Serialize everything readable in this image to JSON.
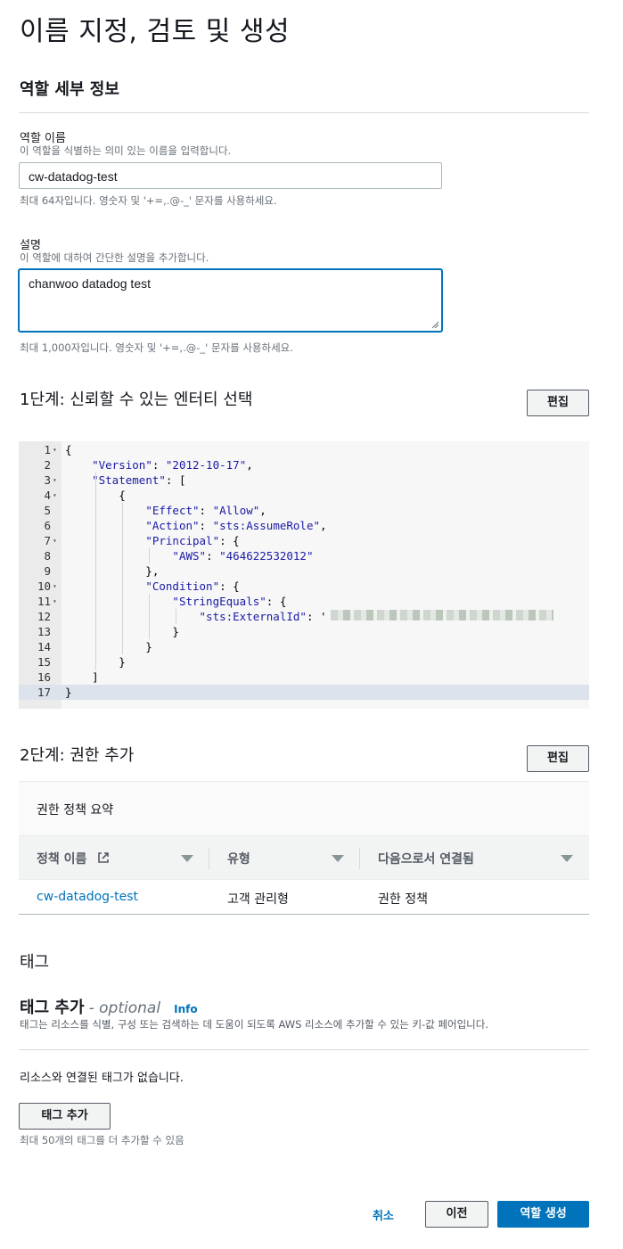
{
  "page": {
    "title": "이름 지정, 검토 및 생성"
  },
  "role_details": {
    "heading": "역할 세부 정보",
    "name": {
      "label": "역할 이름",
      "description": "이 역할을 식별하는 의미 있는 이름을 입력합니다.",
      "value": "cw-datadog-test",
      "hint": "최대 64자입니다. 영숫자 및 '+=,.@-_' 문자를 사용하세요."
    },
    "description": {
      "label": "설명",
      "description": "이 역할에 대하여 간단한 설명을 추가합니다.",
      "value": "chanwoo datadog test",
      "hint": "최대 1,000자입니다. 영숫자 및 '+=,.@-_' 문자를 사용하세요."
    }
  },
  "step1": {
    "heading": "1단계: 신뢰할 수 있는 엔터티 선택",
    "edit_label": "편집",
    "code_lines": [
      {
        "n": "1",
        "fold": true,
        "text": "{"
      },
      {
        "n": "2",
        "fold": false,
        "text": "    \"Version\": \"2012-10-17\","
      },
      {
        "n": "3",
        "fold": true,
        "text": "    \"Statement\": ["
      },
      {
        "n": "4",
        "fold": true,
        "text": "        {"
      },
      {
        "n": "5",
        "fold": false,
        "text": "            \"Effect\": \"Allow\","
      },
      {
        "n": "6",
        "fold": false,
        "text": "            \"Action\": \"sts:AssumeRole\","
      },
      {
        "n": "7",
        "fold": true,
        "text": "            \"Principal\": {"
      },
      {
        "n": "8",
        "fold": false,
        "text": "                \"AWS\": \"464622532012\""
      },
      {
        "n": "9",
        "fold": false,
        "text": "            },"
      },
      {
        "n": "10",
        "fold": true,
        "text": "            \"Condition\": {"
      },
      {
        "n": "11",
        "fold": true,
        "text": "                \"StringEquals\": {"
      },
      {
        "n": "12",
        "fold": false,
        "text": "                    \"sts:ExternalId\": '"
      },
      {
        "n": "13",
        "fold": false,
        "text": "                }"
      },
      {
        "n": "14",
        "fold": false,
        "text": "            }"
      },
      {
        "n": "15",
        "fold": false,
        "text": "        }"
      },
      {
        "n": "16",
        "fold": false,
        "text": "    ]"
      },
      {
        "n": "17",
        "fold": false,
        "text": "}"
      }
    ]
  },
  "step2": {
    "heading": "2단계: 권한 추가",
    "edit_label": "편집",
    "table": {
      "title": "권한 정책 요약",
      "columns": [
        "정책 이름",
        "유형",
        "다음으로서 연결됨"
      ],
      "row": {
        "policy_name": "cw-datadog-test",
        "type": "고객 관리형",
        "attached_as": "권한 정책"
      }
    }
  },
  "tags": {
    "section_label": "태그",
    "heading": "태그 추가",
    "optional": "- optional",
    "info": "Info",
    "description": "태그는 리소스를 식별, 구성 또는 검색하는 데 도움이 되도록 AWS 리소스에 추가할 수 있는 키-값 페어입니다.",
    "empty_text": "리소스와 연결된 태그가 없습니다.",
    "add_button": "태그 추가",
    "limit_hint": "최대 50개의 태그를 더 추가할 수 있음"
  },
  "footer": {
    "cancel": "취소",
    "previous": "이전",
    "create": "역할 생성"
  }
}
